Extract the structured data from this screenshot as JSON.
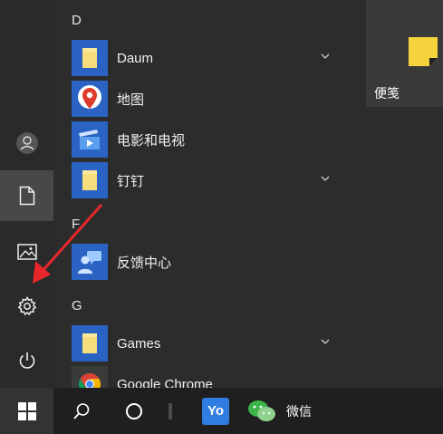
{
  "app_list": {
    "letters": {
      "d": "D",
      "f": "F",
      "g": "G"
    },
    "apps": {
      "daum": "Daum",
      "map": "地图",
      "movies": "电影和电视",
      "dingtalk": "钉钉",
      "feedback": "反馈中心",
      "games": "Games",
      "chrome": "Google Chrome"
    }
  },
  "tiles": {
    "sticky_notes": "便笺"
  },
  "taskbar": {
    "wechat": "微信",
    "yo": "Yo"
  },
  "colors": {
    "accent_blue": "#2b63c4",
    "folder_yellow": "#f6dd7b",
    "map_red": "#e03c2c",
    "arrow_red": "#e8272a",
    "sticky_yellow": "#f5d33c"
  }
}
